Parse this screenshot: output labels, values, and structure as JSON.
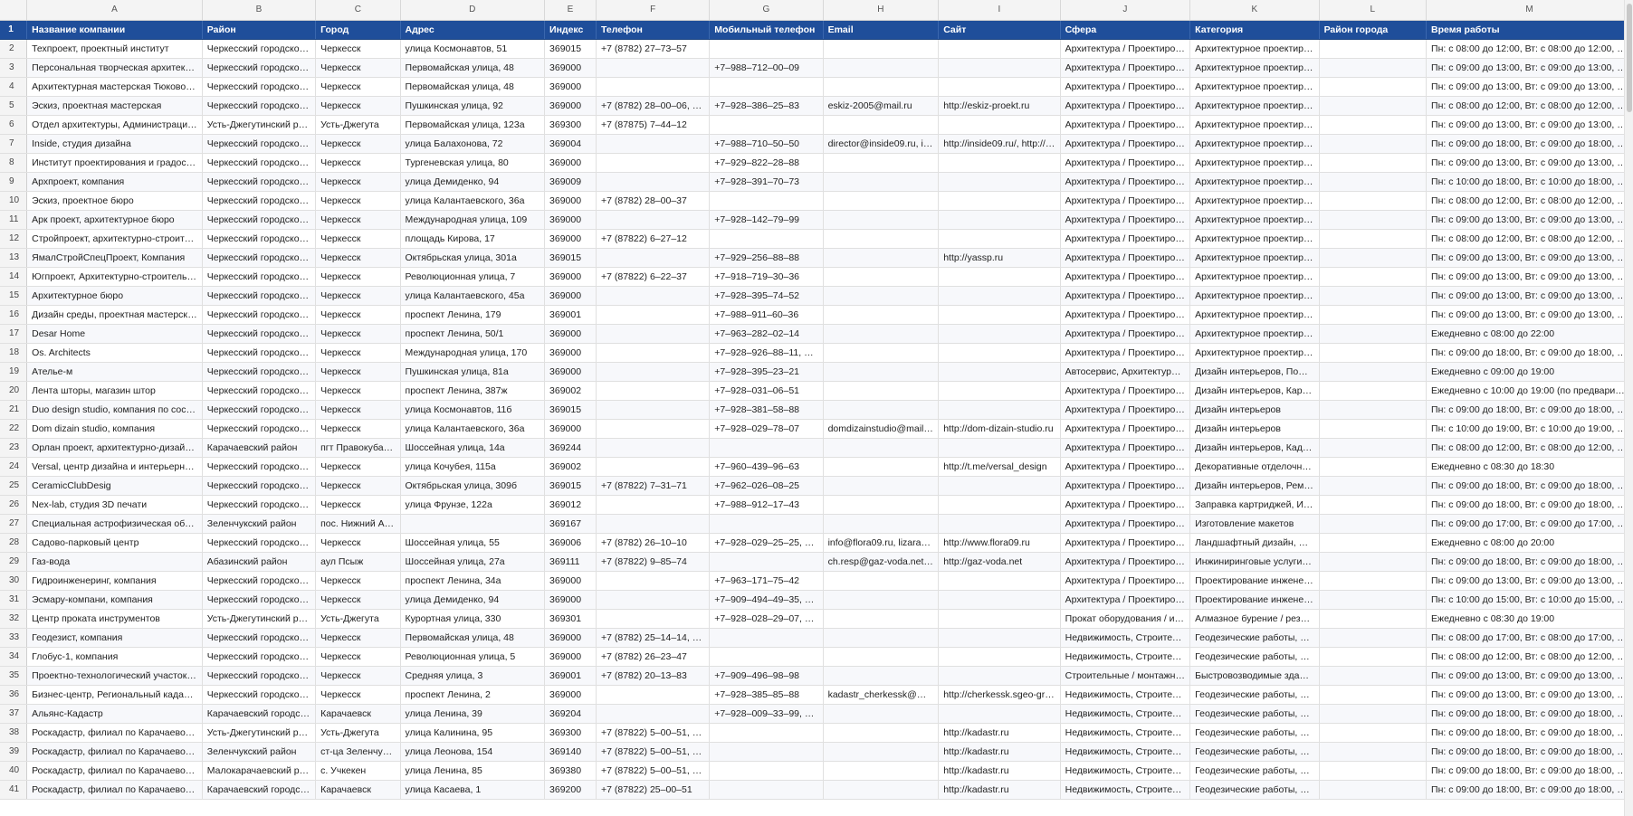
{
  "columns": [
    "A",
    "B",
    "C",
    "D",
    "E",
    "F",
    "G",
    "H",
    "I",
    "J",
    "K",
    "L",
    "M"
  ],
  "header_row": {
    "num": "1",
    "cells": [
      "Название компании",
      "Район",
      "Город",
      "Адрес",
      "Индекс",
      "Телефон",
      "Мобильный телефон",
      "Email",
      "Сайт",
      "Сфера",
      "Категория",
      "Район города",
      "Время работы"
    ]
  },
  "rows": [
    {
      "num": "2",
      "cells": [
        "Техпроект, проектный институт",
        "Черкесский городской…",
        "Черкесск",
        "улица Космонавтов, 51",
        "369015",
        "+7 (8782) 27–73–57",
        "",
        "",
        "",
        "Архитектура / Проектиров…",
        "Архитектурное проектир…",
        "",
        "Пн: с 08:00 до 12:00, Вт: с 08:00 до 12:00, Ср…"
      ]
    },
    {
      "num": "3",
      "cells": [
        "Персональная творческая архитектур…",
        "Черкесский городской…",
        "Черкесск",
        "Первомайская улица, 48",
        "369000",
        "",
        "+7–988–712–00–09",
        "",
        "",
        "Архитектура / Проектиров…",
        "Архитектурное проектир…",
        "",
        "Пн: с 09:00 до 13:00, Вт: с 09:00 до 13:00, С…"
      ]
    },
    {
      "num": "4",
      "cells": [
        "Архитектурная мастерская Тюковой Е…",
        "Черкесский городской…",
        "Черкесск",
        "Первомайская улица, 48",
        "369000",
        "",
        "",
        "",
        "",
        "Архитектура / Проектиров…",
        "Архитектурное проектир…",
        "",
        "Пн: с 09:00 до 13:00, Вт: с 09:00 до 13:00, С…"
      ]
    },
    {
      "num": "5",
      "cells": [
        "Эскиз, проектная мастерская",
        "Черкесский городской…",
        "Черкесск",
        "Пушкинская улица, 92",
        "369000",
        "+7 (8782) 28–00–06, +7…",
        "+7–928–386–25–83",
        "eskiz-2005@mail.ru",
        "http://eskiz-proekt.ru",
        "Архитектура / Проектиров…",
        "Архитектурное проектир…",
        "",
        "Пн: с 08:00 до 12:00, Вт: с 08:00 до 12:00, С…"
      ]
    },
    {
      "num": "6",
      "cells": [
        "Отдел архитектуры, Администрации г…",
        "Усть-Джегутинский ра…",
        "Усть-Джегута",
        "Первомайская улица, 123а",
        "369300",
        "+7 (87875) 7–44–12",
        "",
        "",
        "",
        "Архитектура / Проектиров…",
        "Архитектурное проектир…",
        "",
        "Пн: с 09:00 до 13:00, Вт: с 09:00 до 13:00, С…"
      ]
    },
    {
      "num": "7",
      "cells": [
        "Inside, студия дизайна",
        "Черкесский городской…",
        "Черкесск",
        "улица Балахонова, 72",
        "369004",
        "",
        "+7–988–710–50–50",
        "director@inside09.ru, in…",
        "http://inside09.ru/, http://…",
        "Архитектура / Проектиров…",
        "Архитектурное проектир…",
        "",
        "Пн: с 09:00 до 18:00, Вт: с 09:00 до 18:00, С…"
      ]
    },
    {
      "num": "8",
      "cells": [
        "Институт проектирования и градостр…",
        "Черкесский городской…",
        "Черкесск",
        "Тургеневская улица, 80",
        "369000",
        "",
        "+7–929–822–28–88",
        "",
        "",
        "Архитектура / Проектиров…",
        "Архитектурное проектир…",
        "",
        "Пн: с 09:00 до 13:00, Вт: с 09:00 до 13:00, С…"
      ]
    },
    {
      "num": "9",
      "cells": [
        "Архпроект, компания",
        "Черкесский городской…",
        "Черкесск",
        "улица Демиденко, 94",
        "369009",
        "",
        "+7–928–391–70–73",
        "",
        "",
        "Архитектура / Проектиров…",
        "Архитектурное проектир…",
        "",
        "Пн: с 10:00 до 18:00, Вт: с 10:00 до 18:00, С…"
      ]
    },
    {
      "num": "10",
      "cells": [
        "Эскиз, проектное бюро",
        "Черкесский городской…",
        "Черкесск",
        "улица Калантаевского, 36а",
        "369000",
        "+7 (8782) 28–00–37",
        "",
        "",
        "",
        "Архитектура / Проектиров…",
        "Архитектурное проектир…",
        "",
        "Пн: с 08:00 до 12:00, Вт: с 08:00 до 12:00, С…"
      ]
    },
    {
      "num": "11",
      "cells": [
        "Арк проект, архитектурное бюро",
        "Черкесский городской…",
        "Черкесск",
        "Международная улица, 109",
        "369000",
        "",
        "+7–928–142–79–99",
        "",
        "",
        "Архитектура / Проектиров…",
        "Архитектурное проектир…",
        "",
        "Пн: с 09:00 до 13:00, Вт: с 09:00 до 13:00, С…"
      ]
    },
    {
      "num": "12",
      "cells": [
        "Стройпроект, архитектурно-строител…",
        "Черкесский городской…",
        "Черкесск",
        "площадь Кирова, 17",
        "369000",
        "+7 (87822) 6–27–12",
        "",
        "",
        "",
        "Архитектура / Проектиров…",
        "Архитектурное проектир…",
        "",
        "Пн: с 08:00 до 12:00, Вт: с 08:00 до 12:00, С…"
      ]
    },
    {
      "num": "13",
      "cells": [
        "ЯмалСтройСпецПроект, Компания",
        "Черкесский городской…",
        "Черкесск",
        "Октябрьская улица, 301а",
        "369015",
        "",
        "+7–929–256–88–88",
        "",
        "http://yassp.ru",
        "Архитектура / Проектиров…",
        "Архитектурное проектир…",
        "",
        "Пн: с 09:00 до 13:00, Вт: с 09:00 до 13:00, С…"
      ]
    },
    {
      "num": "14",
      "cells": [
        "Югпроект, Архитектурно-строитель…",
        "Черкесский городской…",
        "Черкесск",
        "Революционная улица, 7",
        "369000",
        "+7 (87822) 6–22–37",
        "+7–918–719–30–36",
        "",
        "",
        "Архитектура / Проектиров…",
        "Архитектурное проектир…",
        "",
        "Пн: с 09:00 до 13:00, Вт: с 09:00 до 13:00, С…"
      ]
    },
    {
      "num": "15",
      "cells": [
        "Архитектурное бюро",
        "Черкесский городской…",
        "Черкесск",
        "улица Калантаевского, 45а",
        "369000",
        "",
        "+7–928–395–74–52",
        "",
        "",
        "Архитектура / Проектиров…",
        "Архитектурное проектир…",
        "",
        "Пн: с 09:00 до 13:00, Вт: с 09:00 до 13:00, С…"
      ]
    },
    {
      "num": "16",
      "cells": [
        "Дизайн среды, проектная мастерская",
        "Черкесский городской…",
        "Черкесск",
        "проспект Ленина, 179",
        "369001",
        "",
        "+7–988–911–60–36",
        "",
        "",
        "Архитектура / Проектиров…",
        "Архитектурное проектир…",
        "",
        "Пн: с 09:00 до 13:00, Вт: с 09:00 до 13:00, С…"
      ]
    },
    {
      "num": "17",
      "cells": [
        "Desar Home",
        "Черкесский городской…",
        "Черкесск",
        "проспект Ленина, 50/1",
        "369000",
        "",
        "+7–963–282–02–14",
        "",
        "",
        "Архитектура / Проектиров…",
        "Архитектурное проектир…",
        "",
        "Ежедневно с 08:00 до 22:00"
      ]
    },
    {
      "num": "18",
      "cells": [
        "Os. Architects",
        "Черкесский городской…",
        "Черкесск",
        "Международная улица, 170",
        "369000",
        "",
        "+7–928–926–88–11, +7…",
        "",
        "",
        "Архитектура / Проектиров…",
        "Архитектурное проектир…",
        "",
        "Пн: с 09:00 до 18:00, Вт: с 09:00 до 18:00, С…"
      ]
    },
    {
      "num": "19",
      "cells": [
        "Ателье-м",
        "Черкесский городской…",
        "Черкесск",
        "Пушкинская улица, 81а",
        "369000",
        "",
        "+7–928–395–23–21",
        "",
        "",
        "Автосервис, Архитектура /…",
        "Дизайн интерьеров, Поши…",
        "",
        "Ежедневно с 09:00 до 19:00"
      ]
    },
    {
      "num": "20",
      "cells": [
        "Лента шторы, магазин штор",
        "Черкесский городской…",
        "Черкесск",
        "проспект Ленина, 387ж",
        "369002",
        "",
        "+7–928–031–06–51",
        "",
        "",
        "Архитектура / Проектиров…",
        "Дизайн интерьеров, Карн…",
        "",
        "Ежедневно с 10:00 до 19:00 (по предвари…"
      ]
    },
    {
      "num": "21",
      "cells": [
        "Duo design studio, компания по соста…",
        "Черкесский городской…",
        "Черкесск",
        "улица Космонавтов, 11б",
        "369015",
        "",
        "+7–928–381–58–88",
        "",
        "",
        "Архитектура / Проектиров…",
        "Дизайн интерьеров",
        "",
        "Пн: с 09:00 до 18:00, Вт: с 09:00 до 18:00, С…"
      ]
    },
    {
      "num": "22",
      "cells": [
        "Dom dizain studio, компания",
        "Черкесский городской…",
        "Черкесск",
        "улица Калантаевского, 36а",
        "369000",
        "",
        "+7–928–029–78–07",
        "domdizainstudio@mail.ru",
        "http://dom-dizain-studio.ru",
        "Архитектура / Проектиров…",
        "Дизайн интерьеров",
        "",
        "Пн: с 10:00 до 19:00, Вт: с 10:00 до 19:00, С…"
      ]
    },
    {
      "num": "23",
      "cells": [
        "Орлан проект, архитектурно-дизайне…",
        "Карачаевский район",
        "пгт Правокубан…",
        "Шоссейная улица, 14а",
        "369244",
        "",
        "",
        "",
        "",
        "Архитектура / Проектиров…",
        "Дизайн интерьеров, Кадас…",
        "",
        "Пн: с 08:00 до 12:00, Вт: с 08:00 до 12:00, С…"
      ]
    },
    {
      "num": "24",
      "cells": [
        "Versal, центр дизайна и интерьерных …",
        "Черкесский городской…",
        "Черкесск",
        "улица Кочубея, 115а",
        "369002",
        "",
        "+7–960–439–96–63",
        "",
        "http://t.me/versal_design",
        "Архитектура / Проектиров…",
        "Декоративные отделочны…",
        "",
        "Ежедневно с 08:30 до 18:30"
      ]
    },
    {
      "num": "25",
      "cells": [
        "CeramicClubDesig",
        "Черкесский городской…",
        "Черкесск",
        "Октябрьская улица, 309б",
        "369015",
        "+7 (87822) 7–31–71",
        "+7–962–026–08–25",
        "",
        "",
        "Архитектура / Проектиров…",
        "Дизайн интерьеров, Ремо…",
        "",
        "Пн: с 09:00 до 18:00, Вт: с 09:00 до 18:00, С…"
      ]
    },
    {
      "num": "26",
      "cells": [
        "Nex-lab, студия 3D печати",
        "Черкесский городской…",
        "Черкесск",
        "улица Фрунзе, 122а",
        "369012",
        "",
        "+7–988–912–17–43",
        "",
        "",
        "Архитектура / Проектиров…",
        "Заправка картриджей, Изг…",
        "",
        "Пн: с 09:00 до 18:00, Вт: с 09:00 до 18:00, С…"
      ]
    },
    {
      "num": "27",
      "cells": [
        "Специальная астрофизическая обсер…",
        "Зеленчукский район",
        "пос. Нижний А…",
        "",
        "369167",
        "",
        "",
        "",
        "",
        "Архитектура / Проектиров…",
        "Изготовление макетов",
        "",
        "Пн: с 09:00 до 17:00, Вт: с 09:00 до 17:00, С…"
      ]
    },
    {
      "num": "28",
      "cells": [
        "Садово-парковый центр",
        "Черкесский городской…",
        "Черкесск",
        "Шоссейная улица, 55",
        "369006",
        "+7 (8782) 26–10–10",
        "+7–928–029–25–25, +7…",
        "info@flora09.ru, lizaraz…",
        "http://www.flora09.ru",
        "Архитектура / Проектиров…",
        "Ландшафтный дизайн, Сад…",
        "",
        "Ежедневно с 08:00 до 20:00"
      ]
    },
    {
      "num": "29",
      "cells": [
        "Газ-вода",
        "Абазинский район",
        "аул Псыж",
        "Шоссейная улица, 27а",
        "369111",
        "+7 (87822) 9–85–74",
        "",
        "ch.resp@gaz-voda.net, …",
        "http://gaz-voda.net",
        "Архитектура / Проектиров…",
        "Инжиниринговые услуги, …",
        "",
        "Пн: с 09:00 до 18:00, Вт: с 09:00 до 18:00, С…"
      ]
    },
    {
      "num": "30",
      "cells": [
        "Гидроинженеринг, компания",
        "Черкесский городской…",
        "Черкесск",
        "проспект Ленина, 34а",
        "369000",
        "",
        "+7–963–171–75–42",
        "",
        "",
        "Архитектура / Проектиров…",
        "Проектирование инженер…",
        "",
        "Пн: с 09:00 до 13:00, Вт: с 09:00 до 13:00, С…"
      ]
    },
    {
      "num": "31",
      "cells": [
        "Эсмару-компани, компания",
        "Черкесский городской…",
        "Черкесск",
        "улица Демиденко, 94",
        "369000",
        "",
        "+7–909–494–49–35, +7…",
        "",
        "",
        "Архитектура / Проектиров…",
        "Проектирование инженер…",
        "",
        "Пн: с 10:00 до 15:00, Вт: с 10:00 до 15:00, С…"
      ]
    },
    {
      "num": "32",
      "cells": [
        "Центр проката инструментов",
        "Усть-Джегутинский ра…",
        "Усть-Джегута",
        "Курортная улица, 330",
        "369301",
        "",
        "+7–928–028–29–07, +7…",
        "",
        "",
        "Прокат оборудования / ин…",
        "Алмазное бурение / резка,…",
        "",
        "Ежедневно с 08:30 до 19:00"
      ]
    },
    {
      "num": "33",
      "cells": [
        "Геодезист, компания",
        "Черкесский городской…",
        "Черкесск",
        "Первомайская улица, 48",
        "369000",
        "+7 (8782) 25–14–14, +7…",
        "",
        "",
        "",
        "Недвижимость, Строитель…",
        "Геодезические работы, Ка…",
        "",
        "Пн: с 08:00 до 17:00, Вт: с 08:00 до 17:00, С…"
      ]
    },
    {
      "num": "34",
      "cells": [
        "Глобус-1, компания",
        "Черкесский городской…",
        "Черкесск",
        "Революционная улица, 5",
        "369000",
        "+7 (8782) 26–23–47",
        "",
        "",
        "",
        "Недвижимость, Строитель…",
        "Геодезические работы, Ка…",
        "",
        "Пн: с 08:00 до 12:00, Вт: с 08:00 до 12:00, С…"
      ]
    },
    {
      "num": "35",
      "cells": [
        "Проектно-технологический участок г…",
        "Черкесский городской…",
        "Черкесск",
        "Средняя улица, 3",
        "369001",
        "+7 (8782) 20–13–83",
        "+7–909–496–98–98",
        "",
        "",
        "Строительные / монтажны…",
        "Быстровозводимые здани…",
        "",
        "Пн: с 09:00 до 13:00, Вт: с 09:00 до 13:00, С…"
      ]
    },
    {
      "num": "36",
      "cells": [
        "Бизнес-центр, Региональный кадастр…",
        "Черкесский городской…",
        "Черкесск",
        "проспект Ленина, 2",
        "369000",
        "",
        "+7–928–385–85–88",
        "kadastr_cherkessk@mai…",
        "http://cherkessk.sgeo-gro…",
        "Недвижимость, Строитель…",
        "Геодезические работы, Ка…",
        "",
        "Пн: с 09:00 до 13:00, Вт: с 09:00 до 13:00, С…"
      ]
    },
    {
      "num": "37",
      "cells": [
        "Альянс-Кадастр",
        "Карачаевский городск…",
        "Карачаевск",
        "улица Ленина, 39",
        "369204",
        "",
        "+7–928–009–33–99, +7…",
        "",
        "",
        "Недвижимость, Строитель…",
        "Геодезические работы, Ка…",
        "",
        "Пн: с 09:00 до 18:00, Вт: с 09:00 до 18:00, С…"
      ]
    },
    {
      "num": "38",
      "cells": [
        "Роскадастр, филиал по Карачаево-Че…",
        "Усть-Джегутинский ра…",
        "Усть-Джегута",
        "улица Калинина, 95",
        "369300",
        "+7 (87822) 5–00–51, +7…",
        "",
        "",
        "http://kadastr.ru",
        "Недвижимость, Строитель…",
        "Геодезические работы, Ка…",
        "",
        "Пн: с 09:00 до 18:00, Вт: с 09:00 до 18:00, С…"
      ]
    },
    {
      "num": "39",
      "cells": [
        "Роскадастр, филиал по Карачаево-Че…",
        "Зеленчукский район",
        "ст-ца Зеленчук…",
        "улица Леонова, 154",
        "369140",
        "+7 (87822) 5–00–51, +7…",
        "",
        "",
        "http://kadastr.ru",
        "Недвижимость, Строитель…",
        "Геодезические работы, Ка…",
        "",
        "Пн: с 09:00 до 18:00, Вт: с 09:00 до 18:00, С…"
      ]
    },
    {
      "num": "40",
      "cells": [
        "Роскадастр, филиал по Карачаево-Че…",
        "Малокарачаевский ра…",
        "с. Учкекен",
        "улица Ленина, 85",
        "369380",
        "+7 (87822) 5–00–51, +7…",
        "",
        "",
        "http://kadastr.ru",
        "Недвижимость, Строитель…",
        "Геодезические работы, Ка…",
        "",
        "Пн: с 09:00 до 18:00, Вт: с 09:00 до 18:00, С…"
      ]
    },
    {
      "num": "41",
      "cells": [
        "Роскадастр, филиал по Карачаево-Че…",
        "Карачаевский городск…",
        "Карачаевск",
        "улица Касаева, 1",
        "369200",
        "+7 (87822) 25–00–51",
        "",
        "",
        "http://kadastr.ru",
        "Недвижимость, Строитель…",
        "Геодезические работы, Ка…",
        "",
        "Пн: с 09:00 до 18:00, Вт: с 09:00 до 18:00, С…"
      ]
    }
  ],
  "colors": {
    "header_bg": "#1f4e9a",
    "header_fg": "#ffffff",
    "grid": "#e0e0e0"
  }
}
